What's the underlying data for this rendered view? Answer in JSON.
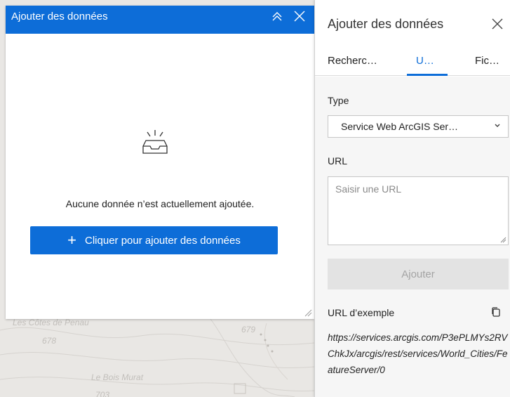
{
  "map": {
    "labels": [
      "Les Côtes de Penau",
      "678",
      "Le Bois Murat",
      "679",
      "703"
    ]
  },
  "left_panel": {
    "title": "Ajouter des données",
    "empty_message": "Aucune donnée n’est actuellement ajoutée.",
    "add_button_icon": "+",
    "add_button_label": "Cliquer pour ajouter des données",
    "collapse_icon": "double-chevron-up-icon",
    "close_icon": "close-icon"
  },
  "right_panel": {
    "title": "Ajouter des données",
    "tabs": [
      {
        "label": "Recherc…",
        "active": false
      },
      {
        "label": "U…",
        "active": true
      },
      {
        "label": "Fic…",
        "active": false
      }
    ],
    "type_label": "Type",
    "type_value": "Service Web ArcGIS Ser…",
    "url_label": "URL",
    "url_placeholder": "Saisir une URL",
    "submit_label": "Ajouter",
    "example_label": "URL d’exemple",
    "example_url": "https://services.arcgis.com/P3ePLMYs2RVChkJx/arcgis/rest/services/World_Cities/FeatureServer/0"
  },
  "colors": {
    "accent": "#0d6dd8",
    "disabled_bg": "#e3e3e3",
    "map_bg": "#e9e7e4"
  }
}
